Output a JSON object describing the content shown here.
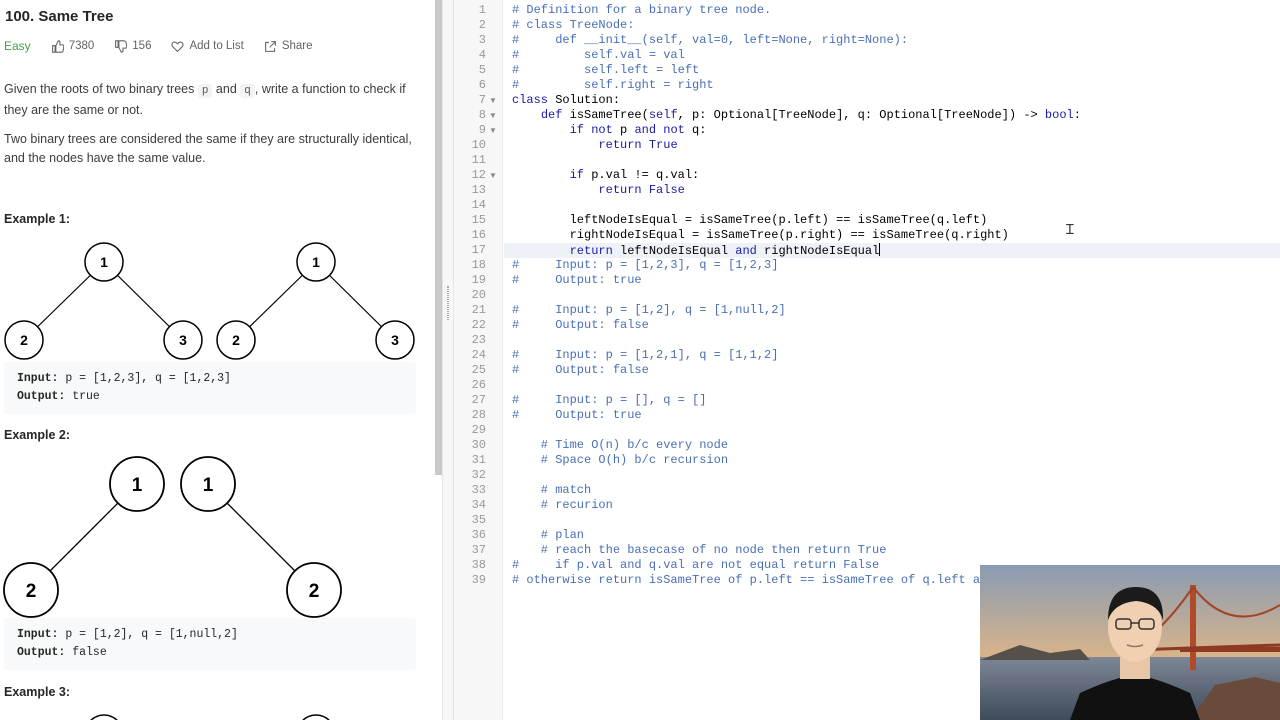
{
  "problem": {
    "title": "100. Same Tree",
    "difficulty": "Easy",
    "likes": "7380",
    "dislikes": "156",
    "add_to_list": "Add to List",
    "share": "Share",
    "desc1_a": "Given the roots of two binary trees ",
    "desc1_p": "p",
    "desc1_and": " and ",
    "desc1_q": "q",
    "desc1_b": ", write a function to check if they are the same or not.",
    "desc2": "Two binary trees are considered the same if they are structurally identical, and the nodes have the same value.",
    "examples": [
      {
        "heading": "Example 1:",
        "input_label": "Input:",
        "input": " p = [1,2,3], q = [1,2,3]",
        "output_label": "Output:",
        "output": " true",
        "tree_p": [
          "1",
          "2",
          "3"
        ],
        "tree_q": [
          "1",
          "2",
          "3"
        ]
      },
      {
        "heading": "Example 2:",
        "input_label": "Input:",
        "input": " p = [1,2], q = [1,null,2]",
        "output_label": "Output:",
        "output": " false",
        "tree_p": [
          "1",
          "2"
        ],
        "tree_q": [
          "1",
          "2"
        ]
      },
      {
        "heading": "Example 3:"
      }
    ]
  },
  "editor": {
    "line_numbers": [
      "1",
      "2",
      "3",
      "4",
      "5",
      "6",
      "7",
      "8",
      "9",
      "10",
      "11",
      "12",
      "13",
      "14",
      "15",
      "16",
      "17",
      "18",
      "19",
      "20",
      "21",
      "22",
      "23",
      "24",
      "25",
      "26",
      "27",
      "28",
      "29",
      "30",
      "31",
      "32",
      "33",
      "34",
      "35",
      "36",
      "37",
      "38",
      "39"
    ],
    "lines": [
      "# Definition for a binary tree node.",
      "# class TreeNode:",
      "#     def __init__(self, val=0, left=None, right=None):",
      "#         self.val = val",
      "#         self.left = left",
      "#         self.right = right",
      "class Solution:",
      "    def isSameTree(self, p: Optional[TreeNode], q: Optional[TreeNode]) -> bool:",
      "        if not p and not q:",
      "            return True",
      "",
      "        if p.val != q.val:",
      "            return False",
      "",
      "        leftNodeIsEqual = isSameTree(p.left) == isSameTree(q.left)",
      "        rightNodeIsEqual = isSameTree(p.right) == isSameTree(q.right)",
      "        return leftNodeIsEqual and rightNodeIsEqual",
      "#     Input: p = [1,2,3], q = [1,2,3]",
      "#     Output: true",
      "",
      "#     Input: p = [1,2], q = [1,null,2]",
      "#     Output: false",
      "",
      "#     Input: p = [1,2,1], q = [1,1,2]",
      "#     Output: false",
      "",
      "#     Input: p = [], q = []",
      "#     Output: true",
      "",
      "    # Time O(n) b/c every node",
      "    # Space O(h) b/c recursion",
      "",
      "    # match",
      "    # recurion",
      "",
      "    # plan",
      "    # reach the basecase of no node then return True",
      "#     if p.val and q.val are not equal return False",
      "# otherwise return isSameTree of p.left == isSameTree of q.left and"
    ],
    "comment_color": "#4a6fb5",
    "keyword_color": "#1a1aa6"
  }
}
